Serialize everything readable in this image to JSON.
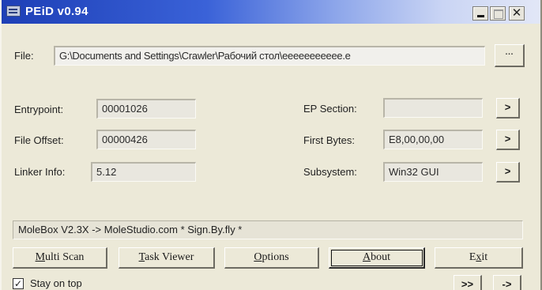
{
  "window": {
    "title": "PEiD v0.94"
  },
  "file": {
    "label": "File:",
    "path": "G:\\Documents and Settings\\Crawler\\Рабочий стол\\еееееееееее.е",
    "browse_label": "..."
  },
  "left_fields": [
    {
      "label": "Entrypoint:",
      "value": "00001026"
    },
    {
      "label": "File Offset:",
      "value": "00000426"
    },
    {
      "label": "Linker Info:",
      "value": "5.12"
    }
  ],
  "right_fields": [
    {
      "label": "EP Section:",
      "value": "",
      "button": ">"
    },
    {
      "label": "First Bytes:",
      "value": "E8,00,00,00",
      "button": ">"
    },
    {
      "label": "Subsystem:",
      "value": "Win32 GUI",
      "button": ">"
    }
  ],
  "status_text": "MoleBox V2.3X -> MoleStudio.com   * Sign.By.fly *",
  "buttons": {
    "multi_scan": {
      "accel": "M",
      "rest": "ulti Scan"
    },
    "task_viewer": {
      "accel": "T",
      "rest": "ask Viewer"
    },
    "options": {
      "accel": "O",
      "rest": "ptions"
    },
    "about": {
      "accel": "A",
      "rest": "bout"
    },
    "exit": {
      "pre": "E",
      "accel": "x",
      "rest": "it"
    }
  },
  "stay_on_top": {
    "label": "Stay on top",
    "checked": "✓"
  },
  "bottom_buttons": {
    "more": ">>",
    "next": "->"
  }
}
